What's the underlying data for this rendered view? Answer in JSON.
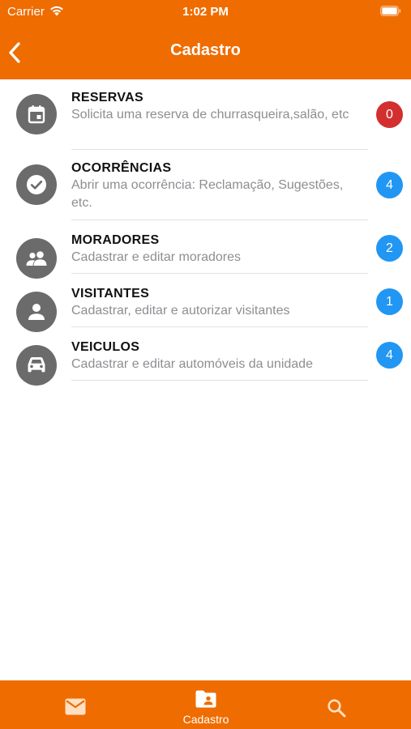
{
  "status_bar": {
    "carrier": "Carrier",
    "time": "1:02 PM"
  },
  "header": {
    "title": "Cadastro"
  },
  "list": {
    "items": [
      {
        "title": "RESERVAS",
        "subtitle": "Solicita uma reserva de churrasqueira,salão, etc",
        "icon": "calendar-icon",
        "badge": "0",
        "badge_color": "#d32f2f"
      },
      {
        "title": "OCORRÊNCIAS",
        "subtitle": "Abrir uma ocorrência: Reclamação, Sugestões, etc.",
        "icon": "check-circle-icon",
        "badge": "4",
        "badge_color": "#2196f3"
      },
      {
        "title": "MORADORES",
        "subtitle": "Cadastrar e editar moradores",
        "icon": "people-icon",
        "badge": "2",
        "badge_color": "#2196f3"
      },
      {
        "title": "VISITANTES",
        "subtitle": "Cadastrar, editar e autorizar visitantes",
        "icon": "person-icon",
        "badge": "1",
        "badge_color": "#2196f3"
      },
      {
        "title": "VEICULOS",
        "subtitle": "Cadastrar e editar automóveis da unidade",
        "icon": "car-icon",
        "badge": "4",
        "badge_color": "#2196f3"
      }
    ]
  },
  "tab_bar": {
    "tabs": [
      {
        "label": "",
        "icon": "mail-icon"
      },
      {
        "label": "Cadastro",
        "icon": "contacts-folder-icon"
      },
      {
        "label": "",
        "icon": "search-icon"
      }
    ]
  },
  "colors": {
    "brand_orange": "#ef6c00",
    "icon_gray": "#6b6b6b",
    "badge_red": "#d32f2f",
    "badge_blue": "#2196f3",
    "subtitle_gray": "#8e8e93"
  }
}
